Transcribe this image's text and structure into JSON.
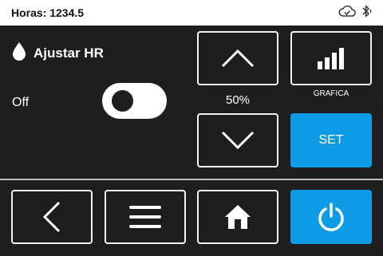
{
  "status_bar": {
    "title": "Horas: 1234.5",
    "icons": [
      "cloud-check-icon",
      "bluetooth-icon"
    ]
  },
  "panel": {
    "icon": "droplet-icon",
    "title": "Ajustar HR",
    "toggle": {
      "label": "Off",
      "state": "off"
    },
    "setpoint": "50%",
    "chart_caption": "GRAFICA",
    "set_label": "SET"
  },
  "nav": {
    "buttons": [
      "back-icon",
      "menu-icon",
      "home-icon",
      "power-icon"
    ]
  },
  "colors": {
    "background": "#1e1e1e",
    "accent": "#0e9be6",
    "foreground": "#ffffff"
  }
}
